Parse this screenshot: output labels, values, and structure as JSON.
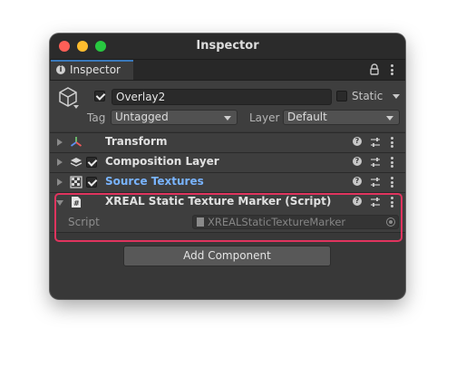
{
  "window": {
    "title": "Inspector"
  },
  "tab": {
    "label": "Inspector",
    "icon": "info-icon"
  },
  "object": {
    "name": "Overlay2",
    "active": true,
    "static_label": "Static",
    "static_checked": false,
    "tag_label": "Tag",
    "tag_value": "Untagged",
    "layer_label": "Layer",
    "layer_value": "Default"
  },
  "components": [
    {
      "name": "Transform",
      "icon": "transform-icon",
      "expanded": false,
      "has_toggle": false
    },
    {
      "name": "Composition Layer",
      "icon": "layers-icon",
      "expanded": false,
      "has_toggle": true,
      "enabled": true
    },
    {
      "name": "Source Textures",
      "icon": "checker-texture-icon",
      "expanded": false,
      "has_toggle": true,
      "enabled": true,
      "color": "#79b4ff"
    },
    {
      "name": "XREAL Static Texture Marker (Script)",
      "icon": "csharp-script-icon",
      "expanded": true,
      "has_toggle": false,
      "highlighted": true
    }
  ],
  "script_field": {
    "label": "Script",
    "value": "XREALStaticTextureMarker"
  },
  "add_component_label": "Add Component",
  "colors": {
    "highlight": "#e0345e",
    "accent_tab": "#3a79bb",
    "link_blue": "#79b4ff"
  }
}
